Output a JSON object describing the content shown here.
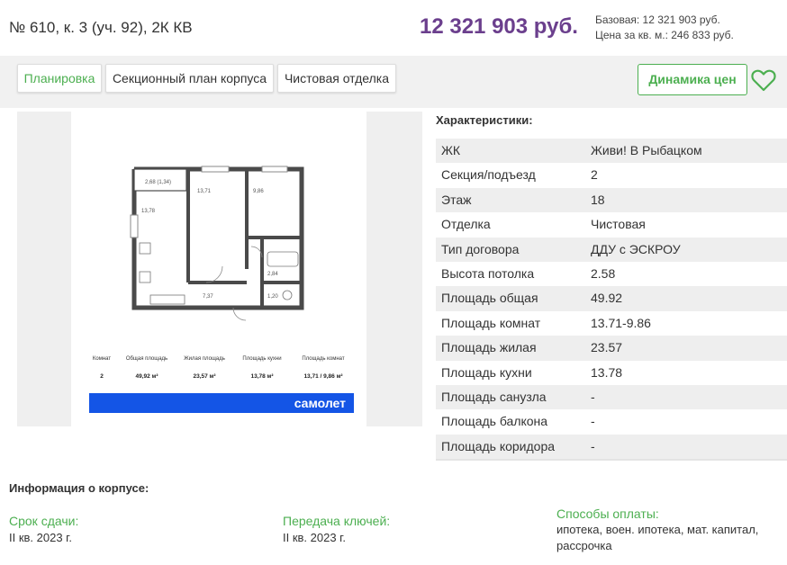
{
  "header": {
    "title": "№ 610, к. 3 (уч. 92), 2К КВ",
    "price": "12 321 903 руб.",
    "base_price": "Базовая: 12 321 903 руб.",
    "price_per_m2": "Цена за кв. м.: 246 833 руб."
  },
  "tabs": [
    {
      "label": "Планировка",
      "active": true
    },
    {
      "label": "Секционный план корпуса",
      "active": false
    },
    {
      "label": "Чистовая отделка",
      "active": false
    }
  ],
  "actions": {
    "dynamics_label": "Динамика цен",
    "favorite_icon": "heart-icon"
  },
  "plan": {
    "room_labels": {
      "balcony": "2,68 (1,34)",
      "kitchen": "13,78",
      "room1": "13,71",
      "room2": "9,86",
      "hall": "7,37",
      "bath": "2,84",
      "wc": "1,20"
    },
    "stats": [
      {
        "label": "Комнат",
        "value": "2"
      },
      {
        "label": "Общая площадь",
        "value": "49,92 м²"
      },
      {
        "label": "Жилая площадь",
        "value": "23,57 м²"
      },
      {
        "label": "Площадь кухни",
        "value": "13,78 м²"
      },
      {
        "label": "Площадь комнат",
        "value": "13,71 / 9,86 м²"
      }
    ],
    "brand": "самолет",
    "brand_color": "#1455e6"
  },
  "characteristics": {
    "title": "Характеристики:",
    "rows": [
      {
        "key": "ЖК",
        "value": "Живи! В Рыбацком"
      },
      {
        "key": "Секция/подъезд",
        "value": "2"
      },
      {
        "key": "Этаж",
        "value": "18"
      },
      {
        "key": "Отделка",
        "value": "Чистовая"
      },
      {
        "key": "Тип договора",
        "value": "ДДУ с ЭСКРОУ"
      },
      {
        "key": "Высота потолка",
        "value": "2.58"
      },
      {
        "key": "Площадь общая",
        "value": "49.92"
      },
      {
        "key": "Площадь комнат",
        "value": "13.71-9.86"
      },
      {
        "key": "Площадь жилая",
        "value": "23.57"
      },
      {
        "key": "Площадь кухни",
        "value": "13.78"
      },
      {
        "key": "Площадь санузла",
        "value": "-"
      },
      {
        "key": "Площадь балкона",
        "value": "-"
      },
      {
        "key": "Площадь коридора",
        "value": "-"
      }
    ]
  },
  "building": {
    "title": "Информация о корпусе:",
    "deadline_label": "Срок сдачи:",
    "deadline_value": "II кв. 2023 г.",
    "keys_label": "Передача ключей:",
    "keys_value": "II кв. 2023 г.",
    "payment_label": "Способы оплаты:",
    "payment_value_1": "ипотека, воен. ипотека, мат. капитал,",
    "payment_value_2": "рассрочка"
  },
  "colors": {
    "accent_green": "#4caf50",
    "price_purple": "#6b3f8d"
  }
}
